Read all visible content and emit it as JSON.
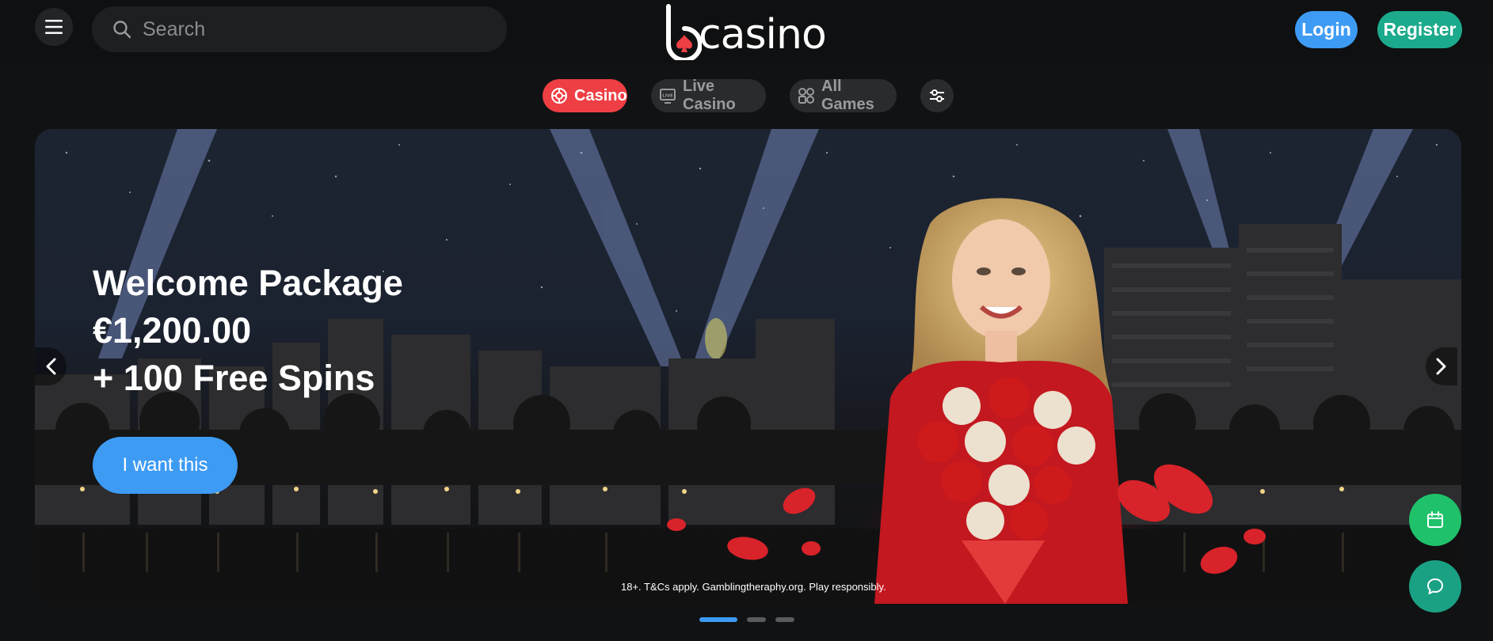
{
  "header": {
    "menu_icon": "hamburger-icon",
    "search": {
      "placeholder": "Search",
      "value": "",
      "icon": "search-icon"
    },
    "logo": {
      "text": "casino"
    },
    "login_label": "Login",
    "register_label": "Register"
  },
  "tabs": [
    {
      "label": "Casino",
      "icon": "casino-chip-icon",
      "active": true
    },
    {
      "label": "Live Casino",
      "icon": "live-tv-icon",
      "active": false
    },
    {
      "label": "All Games",
      "icon": "grid-icon",
      "active": false
    },
    {
      "label": "",
      "icon": "filter-sliders-icon",
      "active": false
    }
  ],
  "banner": {
    "headline": [
      "Welcome Package",
      "€1,200.00",
      "+ 100 Free Spins"
    ],
    "cta_label": "I want this",
    "disclaimer": "18+. T&Cs apply. Gamblingtheraphy.org. Play responsibly."
  },
  "carousel": {
    "slides": 3,
    "active_index": 0
  },
  "floating": {
    "calendar_icon": "calendar-icon",
    "chat_icon": "chat-icon"
  },
  "colors": {
    "accent_blue": "#3d9bf4",
    "register_green": "#1caa8c",
    "active_red": "#ee3f44",
    "calendar_green": "#1fc26a",
    "chat_teal": "#1aa184"
  }
}
